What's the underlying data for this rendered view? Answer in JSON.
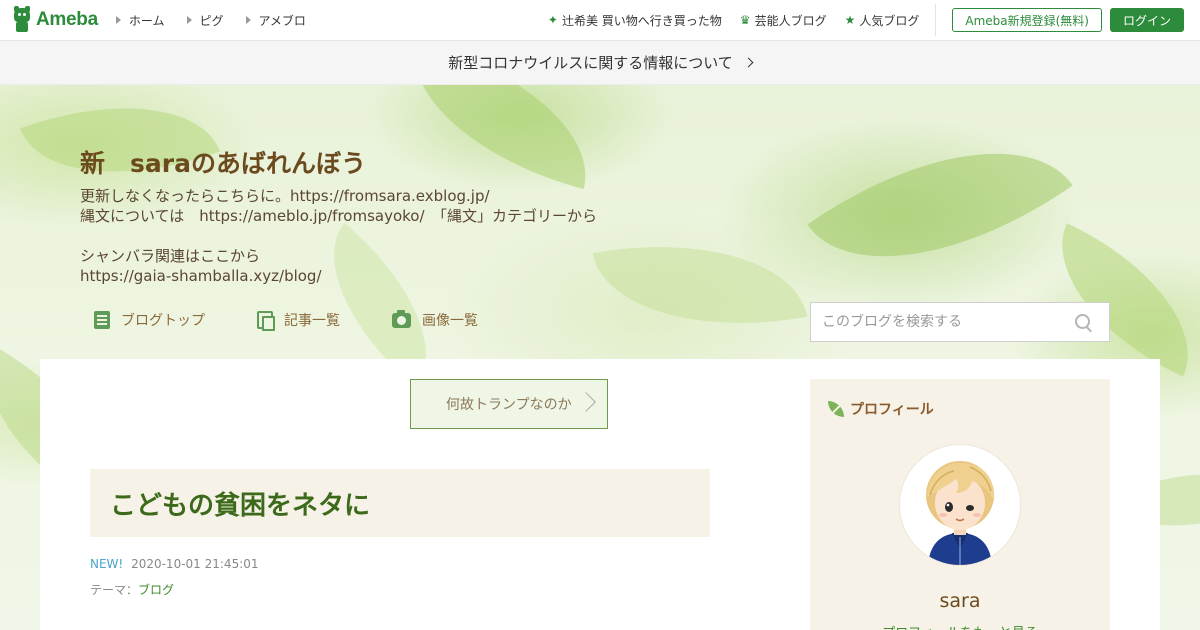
{
  "header": {
    "logo_text": "Ameba",
    "nav_left": [
      "ホーム",
      "ピグ",
      "アメブロ"
    ],
    "nav_right": [
      {
        "icon": "sparkle-icon",
        "glyph": "✦",
        "label": "辻希美 買い物へ行き買った物"
      },
      {
        "icon": "crown-icon",
        "glyph": "♛",
        "label": "芸能人ブログ"
      },
      {
        "icon": "star-icon",
        "glyph": "★",
        "label": "人気ブログ"
      }
    ],
    "register_label": "Ameba新規登録(無料)",
    "login_label": "ログイン"
  },
  "notice": {
    "text": "新型コロナウイルスに関する情報について"
  },
  "blog": {
    "title": "新　saraのあばれんぼう",
    "description": [
      "更新しなくなったらこちらに。https://fromsara.exblog.jp/",
      "縄文については　https://ameblo.jp/fromsayoko/　「縄文」カテゴリーから",
      "",
      "シャンバラ関連はここから",
      "https://gaia-shamballa.xyz/blog/"
    ],
    "nav": [
      {
        "icon": "list-icon",
        "label": "ブログトップ"
      },
      {
        "icon": "documents-icon",
        "label": "記事一覧"
      },
      {
        "icon": "camera-icon",
        "label": "画像一覧"
      }
    ],
    "search_placeholder": "このブログを検索する"
  },
  "article": {
    "prev_link": "何故トランプなのか",
    "title": "こどもの貧困をネタに",
    "new_badge": "NEW!",
    "datetime": "2020-10-01 21:45:01",
    "theme_label": "テーマ：",
    "theme_value": "ブログ"
  },
  "profile": {
    "heading": "プロフィール",
    "name": "sara",
    "more": "プロフィールをもっと見る"
  },
  "colors": {
    "brand_green": "#2d8c3c",
    "title_brown": "#6b4a1e",
    "article_title_green": "#3c6a1a"
  }
}
